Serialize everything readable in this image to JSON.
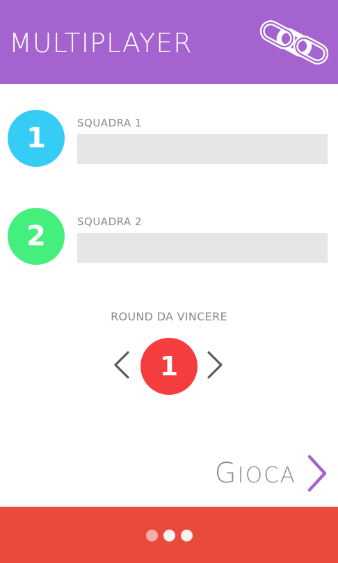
{
  "header": {
    "title": "MULTIPLAYER",
    "icon": "chain-link-icon",
    "color": "#a463cf"
  },
  "teams": [
    {
      "number": "1",
      "label": "SQUADRA 1",
      "value": "",
      "color": "#35ccf5"
    },
    {
      "number": "2",
      "label": "SQUADRA 2",
      "value": "",
      "color": "#44ef7d"
    }
  ],
  "rounds": {
    "label": "ROUND DA VINCERE",
    "value": "1",
    "color": "#f53d3f",
    "prev_icon": "chevron-left-icon",
    "next_icon": "chevron-right-icon"
  },
  "play": {
    "label_first": "G",
    "label_rest": "IOCA",
    "icon": "chevron-right-icon",
    "icon_color": "#a463cf"
  },
  "footer": {
    "color": "#e84b3c",
    "more_icon": "more-dots-icon"
  }
}
